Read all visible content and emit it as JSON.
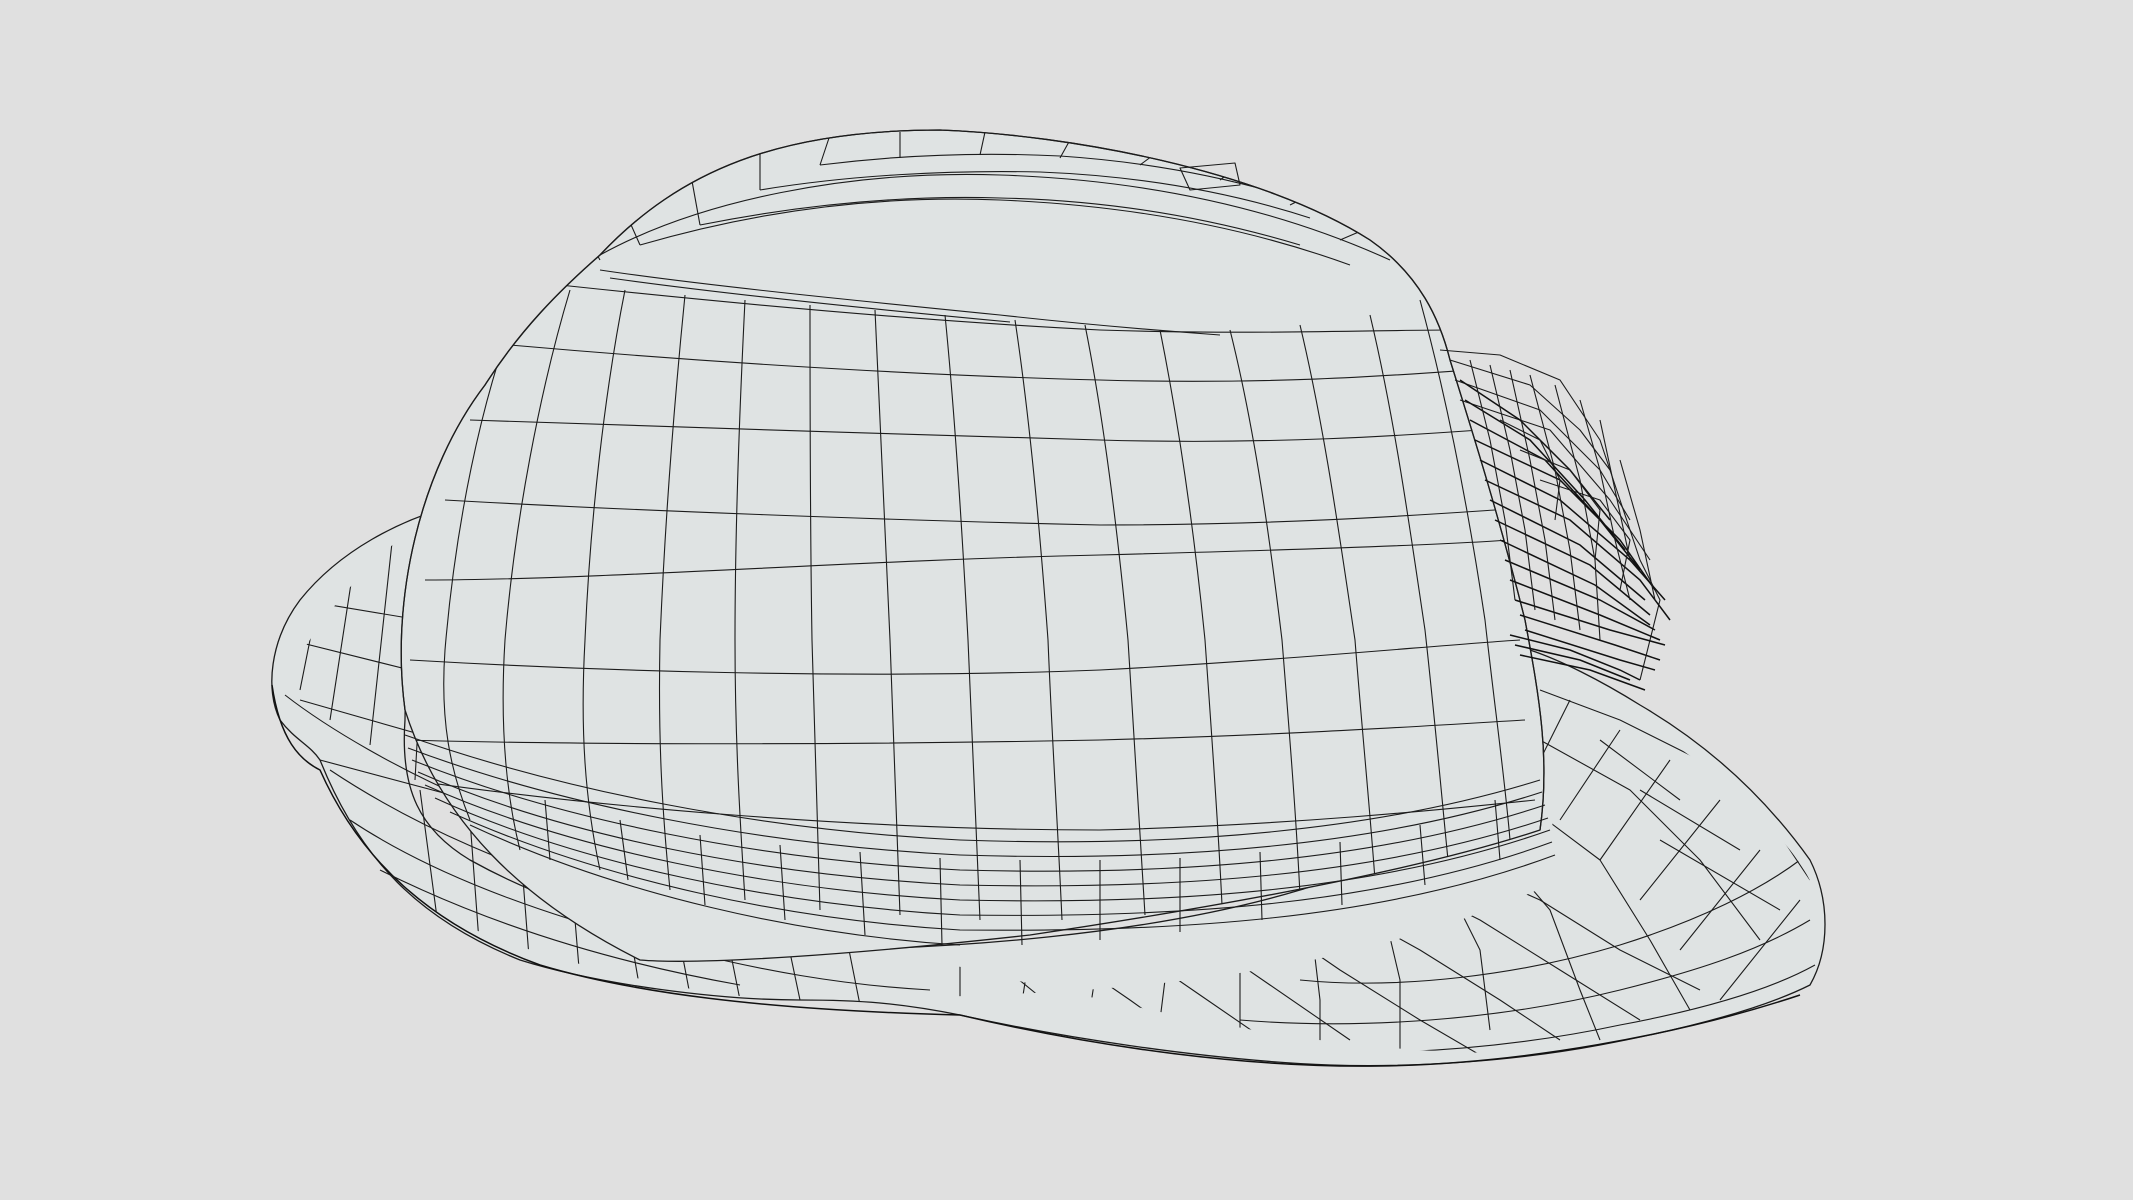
{
  "viewport": {
    "background_color": "#e0e0e0",
    "surface_color": "#dfe3e3",
    "wire_color": "#1c1c1c",
    "render_mode": "wireframe"
  },
  "model": {
    "parts": [
      "crown",
      "brim",
      "hat-band",
      "feather-plume"
    ]
  }
}
